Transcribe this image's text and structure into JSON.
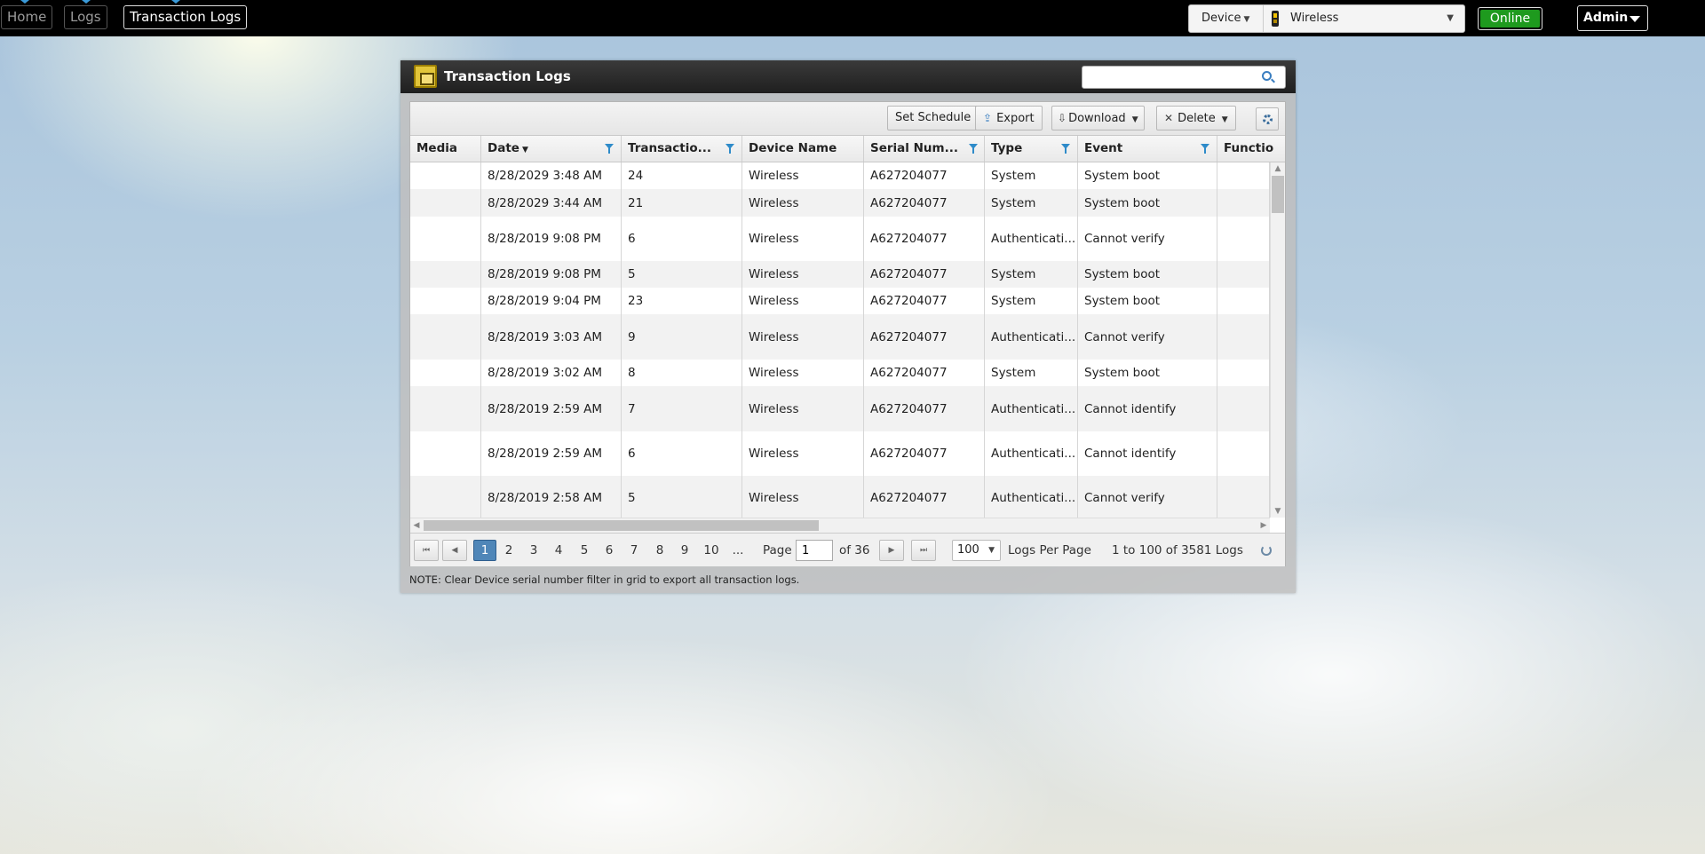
{
  "nav": {
    "home": "Home",
    "logs": "Logs",
    "transaction_logs": "Transaction Logs"
  },
  "device_selector": {
    "label": "Device",
    "selected": "Wireless"
  },
  "status": "Online",
  "user_menu": "Admin",
  "window": {
    "title": "Transaction Logs",
    "search_placeholder": ""
  },
  "toolbar": {
    "set_schedule": "Set Schedule",
    "export": "Export",
    "download": "Download",
    "delete": "Delete"
  },
  "columns": [
    "Media",
    "Date",
    "Transactio...",
    "Device Name",
    "Serial Num...",
    "Type",
    "Event",
    "Functio"
  ],
  "rows": [
    {
      "media": "",
      "date": "8/28/2029 3:48 AM",
      "txn": "24",
      "device": "Wireless",
      "serial": "A627204077",
      "type": "System",
      "event": "System boot",
      "function": ""
    },
    {
      "media": "",
      "date": "8/28/2029 3:44 AM",
      "txn": "21",
      "device": "Wireless",
      "serial": "A627204077",
      "type": "System",
      "event": "System boot",
      "function": ""
    },
    {
      "media": "",
      "date": "8/28/2019 9:08 PM",
      "txn": "6",
      "device": "Wireless",
      "serial": "A627204077",
      "type": "Authenticati...",
      "event": "Cannot verify",
      "function": ""
    },
    {
      "media": "",
      "date": "8/28/2019 9:08 PM",
      "txn": "5",
      "device": "Wireless",
      "serial": "A627204077",
      "type": "System",
      "event": "System boot",
      "function": ""
    },
    {
      "media": "",
      "date": "8/28/2019 9:04 PM",
      "txn": "23",
      "device": "Wireless",
      "serial": "A627204077",
      "type": "System",
      "event": "System boot",
      "function": ""
    },
    {
      "media": "",
      "date": "8/28/2019 3:03 AM",
      "txn": "9",
      "device": "Wireless",
      "serial": "A627204077",
      "type": "Authenticati...",
      "event": "Cannot verify",
      "function": ""
    },
    {
      "media": "",
      "date": "8/28/2019 3:02 AM",
      "txn": "8",
      "device": "Wireless",
      "serial": "A627204077",
      "type": "System",
      "event": "System boot",
      "function": ""
    },
    {
      "media": "",
      "date": "8/28/2019 2:59 AM",
      "txn": "7",
      "device": "Wireless",
      "serial": "A627204077",
      "type": "Authenticati...",
      "event": "Cannot identify",
      "function": ""
    },
    {
      "media": "",
      "date": "8/28/2019 2:59 AM",
      "txn": "6",
      "device": "Wireless",
      "serial": "A627204077",
      "type": "Authenticati...",
      "event": "Cannot identify",
      "function": ""
    },
    {
      "media": "",
      "date": "8/28/2019 2:58 AM",
      "txn": "5",
      "device": "Wireless",
      "serial": "A627204077",
      "type": "Authenticati...",
      "event": "Cannot verify",
      "function": ""
    }
  ],
  "pager": {
    "pages": [
      "1",
      "2",
      "3",
      "4",
      "5",
      "6",
      "7",
      "8",
      "9",
      "10",
      "..."
    ],
    "current_page": "1",
    "page_label": "Page",
    "page_value": "1",
    "of_label": "of 36",
    "page_size": "100",
    "page_size_label": "Logs Per Page",
    "summary": "1 to 100 of 3581 Logs"
  },
  "note": "NOTE: Clear Device serial number filter in grid to export all transaction logs.",
  "colors": {
    "status_green": "#1e9a1e",
    "pager_current": "#4f86b8",
    "filter_blue": "#2e8bc9"
  }
}
